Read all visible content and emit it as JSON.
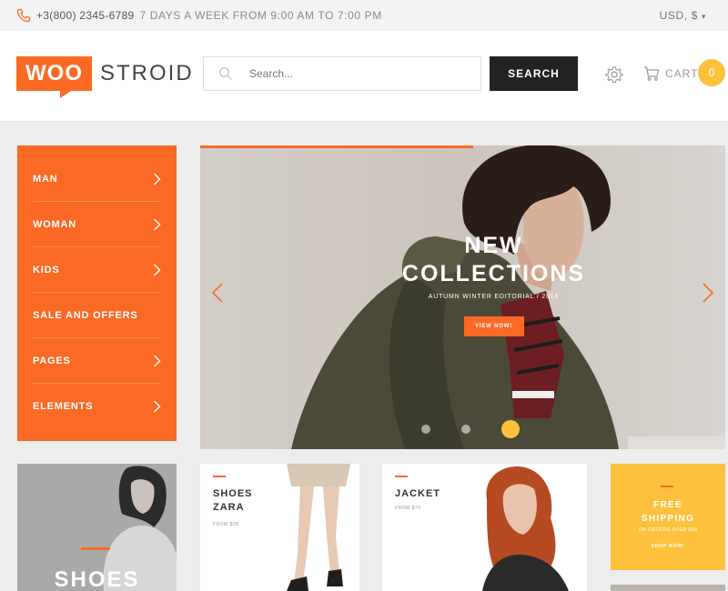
{
  "topbar": {
    "phone": "+3(800) 2345-6789",
    "hours": "7 DAYS A WEEK FROM 9:00 AM TO 7:00 PM",
    "currency": "USD, $"
  },
  "header": {
    "logo_woo": "WOO",
    "logo_stroid": "STROID",
    "search_placeholder": "Search...",
    "search_button": "SEARCH",
    "cart_label": "CART",
    "cart_count": "0"
  },
  "menu": {
    "items": [
      {
        "label": "MAN",
        "has_arrow": true
      },
      {
        "label": "WOMAN",
        "has_arrow": true
      },
      {
        "label": "KIDS",
        "has_arrow": true
      },
      {
        "label": "SALE AND OFFERS",
        "has_arrow": false
      },
      {
        "label": "PAGES",
        "has_arrow": true
      },
      {
        "label": "ELEMENTS",
        "has_arrow": true
      }
    ]
  },
  "hero": {
    "title_line1": "NEW",
    "title_line2": "COLLECTIONS",
    "subtitle": "AUTUMN WINTER EDITORIAL / 2016",
    "button": "VIEW NOW!",
    "slides_count": 3,
    "active_slide": 3
  },
  "cards": {
    "shoes_big": {
      "label": "SHOES"
    },
    "zara": {
      "title_line1": "SHOES",
      "title_line2": "ZARA",
      "price": "FROM $28"
    },
    "jacket": {
      "title": "JACKET",
      "price": "FROM $79"
    },
    "shipping": {
      "title_line1": "FREE",
      "title_line2": "SHIPPING",
      "subtitle": "ON ORDERS OVER $99",
      "button": "SHOP NOW!"
    }
  },
  "colors": {
    "accent": "#fa6a25",
    "yellow": "#fdc13e",
    "dark": "#222222"
  }
}
